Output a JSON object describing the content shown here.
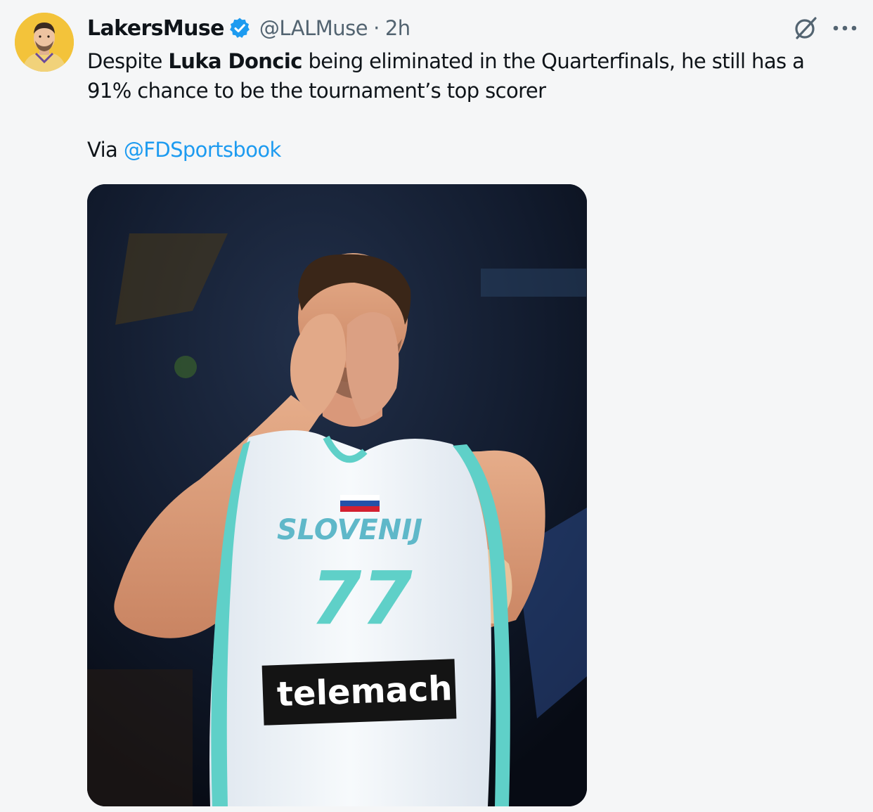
{
  "tweet": {
    "display_name": "LakersMuse",
    "handle": "@LALMuse",
    "separator": "·",
    "time": "2h",
    "text_part1": "Despite ",
    "text_bold": "Luka Doncic",
    "text_part2": " being eliminated in the Quarterfinals, he still has a 91% chance to be the tournament’s top scorer",
    "via_label": "Via ",
    "via_mention": "@FDSportsbook"
  },
  "media": {
    "jersey_country": "SLOVENIJ",
    "jersey_number": "77",
    "jersey_sponsor": "telemach"
  },
  "icons": {
    "verified": "verified-badge-icon",
    "grok": "grok-icon",
    "more": "more-dots-icon"
  },
  "colors": {
    "background": "#f5f6f7",
    "accent": "#1d9bf0",
    "secondary_text": "#536471",
    "avatar_bg": "#f3c33a",
    "jersey_teal": "#5fd0c8"
  }
}
